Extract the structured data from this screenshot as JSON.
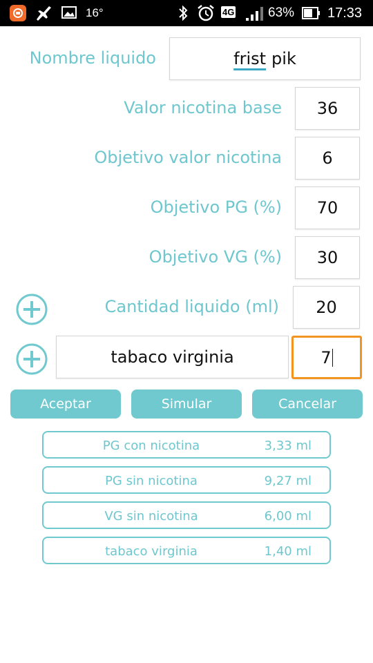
{
  "status_bar": {
    "temperature": "16°",
    "network": "4G",
    "battery": "63%",
    "time": "17:33"
  },
  "form": {
    "nombre": {
      "label": "Nombre liquido",
      "value_word1": "frist",
      "value_word2": "pik"
    },
    "nicotina_base": {
      "label": "Valor nicotina base",
      "value": "36"
    },
    "objetivo_nicotina": {
      "label": "Objetivo valor nicotina",
      "value": "6"
    },
    "objetivo_pg": {
      "label": "Objetivo PG (%)",
      "value": "70"
    },
    "objetivo_vg": {
      "label": "Objetivo VG (%)",
      "value": "30"
    },
    "cantidad": {
      "label": "Cantidad liquido (ml)",
      "value": "20"
    },
    "aroma": {
      "name": "tabaco virginia",
      "value": "7"
    }
  },
  "buttons": {
    "aceptar": "Aceptar",
    "simular": "Simular",
    "cancelar": "Cancelar"
  },
  "results": [
    {
      "name": "PG con nicotina",
      "value": "3,33 ml"
    },
    {
      "name": "PG sin nicotina",
      "value": "9,27 ml"
    },
    {
      "name": "VG sin nicotina",
      "value": "6,00 ml"
    },
    {
      "name": "tabaco virginia",
      "value": "1,40 ml"
    }
  ],
  "colors": {
    "accent": "#6fc9ce",
    "focus": "#f29422",
    "status_bar": "#000000"
  },
  "icons": [
    "app-notification-icon",
    "airplane-icon",
    "image-icon",
    "bluetooth-icon",
    "alarm-icon",
    "signal-icon",
    "battery-icon",
    "add-circle-icon"
  ]
}
